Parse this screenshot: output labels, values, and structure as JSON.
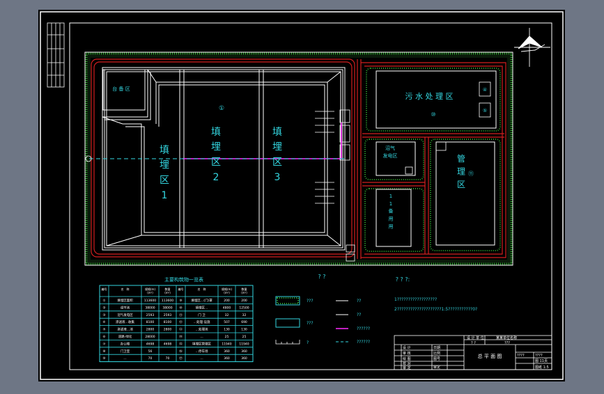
{
  "drawing": {
    "zones": {
      "landfill_1": {
        "label": "填\n埋\n区\n1",
        "num": ""
      },
      "landfill_2": {
        "label": "填\n埋\n区\n2",
        "num": "①"
      },
      "landfill_3": {
        "label": "填\n埋\n区\n3",
        "num": ""
      },
      "sewage": {
        "label": "污 水 处 理 区",
        "num": "⑩"
      },
      "management": {
        "label": "管\n\n理\n\n区",
        "num": "⑪"
      },
      "top_left": {
        "label": "台 备 区",
        "num": "⑬"
      },
      "mid_right": {
        "label": "沼气\n发电区",
        "num": "⑫"
      },
      "lower_mid": {
        "label": "1\n1\n备\n用\n用",
        "num": ""
      },
      "right_nums": [
        "④",
        "⑤"
      ],
      "left_circle": "⑩"
    },
    "table": {
      "title": "主要构筑物一览表",
      "headers": [
        "编号",
        "名　称",
        "规格(m)\n(m²)",
        "数量\n(m²)",
        "编号",
        "名　称",
        "规格(m)\n(m²)",
        "数量\n(m²)"
      ],
      "rows": [
        [
          "①",
          "填埋区面积",
          "113600",
          "113600",
          "⑨",
          "填埋区…(门)罩",
          "200",
          "200"
        ],
        [
          "②",
          "调节池",
          "38000",
          "38000",
          "⑩",
          "填埋区…",
          "4800",
          "12500"
        ],
        [
          "③",
          "沼气发电区",
          "2593",
          "2593",
          "⑪",
          "门 卫",
          "32",
          "32"
        ],
        [
          "④",
          "渗滤液…收集",
          "8100",
          "8100",
          "⑫",
          "…处理·设施",
          "507",
          "690"
        ],
        [
          "⑤",
          "渗滤液…池",
          "2800",
          "2800",
          "⑬",
          "…处理池",
          "130",
          "130"
        ],
        [
          "⑥",
          "道路·绿化",
          "28000",
          "",
          "⑭",
          "…",
          "25",
          "25"
        ],
        [
          "⑦",
          "办公楼",
          "4698",
          "4698",
          "⑮",
          "填埋区管理区",
          "11940",
          "11940"
        ],
        [
          "⑧",
          "门卫室",
          "56",
          "",
          "⑯",
          "…停车场",
          "360",
          "360"
        ],
        [
          "⑨",
          "…",
          "70",
          "70",
          "⑰",
          "…",
          "360",
          "360"
        ]
      ]
    },
    "legend": {
      "title": "? ?",
      "items": [
        {
          "sym": "hatch",
          "label": "???"
        },
        {
          "sym": "box",
          "label": "???"
        },
        {
          "sym": "fence",
          "label": "?"
        },
        {
          "sym": "line",
          "label": "??"
        },
        {
          "sym": "line",
          "label": "??"
        },
        {
          "sym": "magenta",
          "label": "??????"
        },
        {
          "sym": "dash",
          "label": "??????"
        }
      ]
    },
    "notes": {
      "title": "? ? ?:",
      "line1": "1??????????????????",
      "line2": "2????????????????????1:5???????????0?"
    },
    "title_block": {
      "name": "总 平 面 图",
      "r1": "设 计 单 位",
      "r1b": "某某单位名称",
      "r2a": "? ?",
      "r2b": "???",
      "rows": [
        "设 计",
        "审 核",
        "绘 图",
        "校 对",
        "审 定"
      ],
      "mid": [
        "日期",
        "比例",
        "图号",
        "审定"
      ],
      "right": [
        "????",
        "????",
        "图 11页",
        "图纸 1:5"
      ]
    }
  }
}
